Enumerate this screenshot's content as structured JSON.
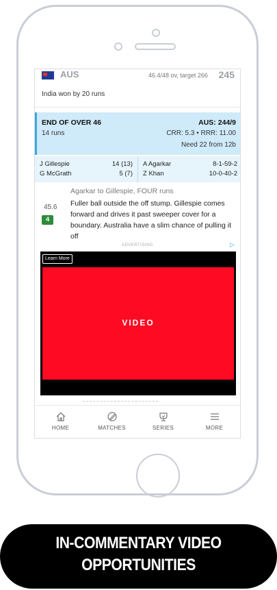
{
  "header": {
    "team": "AUS",
    "overs_target": "46.4/48 ov, target 266",
    "score": "245",
    "result": "India won by 20 runs"
  },
  "end_of_over": {
    "title": "END OF OVER 46",
    "runs": "14 runs",
    "team_score": "AUS: 244/9",
    "rates": "CRR: 5.3 • RRR: 11.00",
    "need": "Need 22 from 12b"
  },
  "batsmen": [
    {
      "name": "J Gillespie",
      "stat": "14 (13)"
    },
    {
      "name": "G McGrath",
      "stat": "5 (7)"
    }
  ],
  "bowlers": [
    {
      "name": "A Agarkar",
      "stat": "8-1-59-2"
    },
    {
      "name": "Z Khan",
      "stat": "10-0-40-2"
    }
  ],
  "ball": {
    "headline": "Agarkar to Gillespie, FOUR runs",
    "number": "45.6",
    "runs_badge": "4",
    "commentary": "Fuller ball outside the off stump. Gillespie comes forward and drives it past sweeper cover for a boundary. Australia have a slim chance of pulling it off"
  },
  "ad": {
    "label": "ADVERTISING",
    "info_icon": "▷",
    "learn_more": "Learn More",
    "video_label": "VIDEO",
    "colors": {
      "video_bg": "#ff0a23"
    }
  },
  "tabs": [
    {
      "label": "HOME",
      "icon": "home-icon"
    },
    {
      "label": "MATCHES",
      "icon": "ball-icon"
    },
    {
      "label": "SERIES",
      "icon": "trophy-icon"
    },
    {
      "label": "MORE",
      "icon": "menu-icon"
    }
  ],
  "banner": {
    "line1": "IN-COMMENTARY VIDEO",
    "line2": "OPPORTUNITIES"
  }
}
